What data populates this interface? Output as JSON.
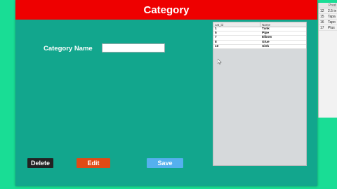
{
  "window": {
    "title": "Category"
  },
  "form": {
    "category_label": "Category Name",
    "category_value": ""
  },
  "table": {
    "columns": [
      "cat_id",
      "Name"
    ],
    "rows": [
      {
        "id": "1",
        "name": "Tank"
      },
      {
        "id": "5",
        "name": "Pipe"
      },
      {
        "id": "7",
        "name": "Elbow"
      },
      {
        "id": "8",
        "name": "Glue"
      },
      {
        "id": "10",
        "name": "Sink"
      }
    ]
  },
  "buttons": {
    "delete": "Delete",
    "edit": "Edit",
    "save": "Save"
  },
  "background_window": {
    "header": "Prod",
    "rows": [
      {
        "id": "12",
        "name": "2.5 in"
      },
      {
        "id": "15",
        "name": "Tapa"
      },
      {
        "id": "16",
        "name": "Tapo"
      },
      {
        "id": "17",
        "name": "Plus"
      }
    ]
  },
  "colors": {
    "desktop": "#19dd95",
    "window_bg": "#12a68d",
    "title_bar": "#ee0000",
    "delete": "#222222",
    "edit": "#e04a16",
    "save": "#55b0ee"
  }
}
